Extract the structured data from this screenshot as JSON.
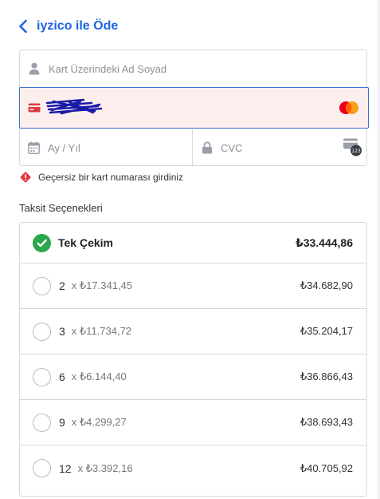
{
  "header": {
    "title": "iyzico ile Öde"
  },
  "form": {
    "name_placeholder": "Kart Üzerindeki Ad Soyad",
    "expiry_placeholder": "Ay / Yıl",
    "cvc_placeholder": "CVC",
    "cvc_badge": "123",
    "card_brand": "mastercard-logo-icon",
    "error_color": "#e0393e",
    "focus_color": "#3a6fd0"
  },
  "error": {
    "message": "Geçersiz bir kart numarası girdiniz"
  },
  "installments": {
    "title": "Taksit Seçenekleri",
    "options": [
      {
        "count": "Tek Çekim",
        "per_installment": "",
        "total": "₺33.444,86",
        "selected": true
      },
      {
        "count": "2",
        "per_installment": "x ₺17.341,45",
        "total": "₺34.682,90",
        "selected": false
      },
      {
        "count": "3",
        "per_installment": "x ₺11.734,72",
        "total": "₺35.204,17",
        "selected": false
      },
      {
        "count": "6",
        "per_installment": "x ₺6.144,40",
        "total": "₺36.866,43",
        "selected": false
      },
      {
        "count": "9",
        "per_installment": "x ₺4.299,27",
        "total": "₺38.693,43",
        "selected": false
      },
      {
        "count": "12",
        "per_installment": "x ₺3.392,16",
        "total": "₺40.705,92",
        "selected": false
      }
    ]
  }
}
